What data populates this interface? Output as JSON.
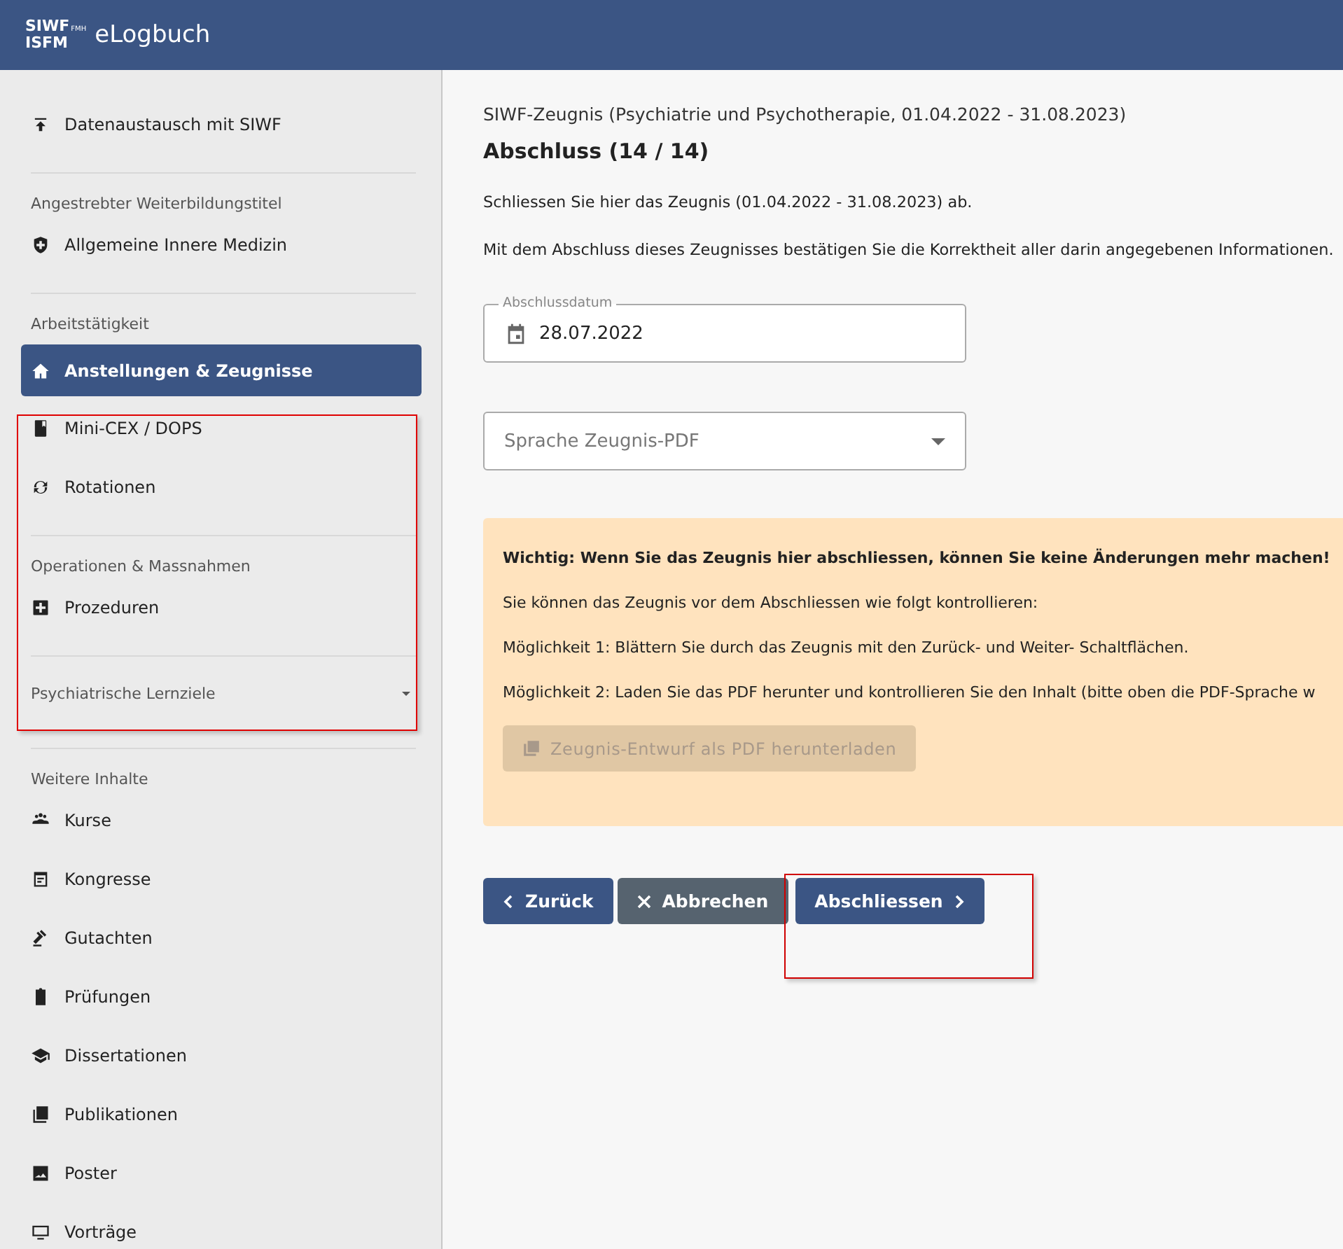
{
  "header": {
    "logo_top": "SIWF",
    "logo_sub": "FMH",
    "logo_bottom": "ISFM",
    "app_name": "eLogbuch"
  },
  "sidebar": {
    "groups": [
      {
        "kind": "links",
        "items": [
          {
            "label": "Datenaustausch mit SIWF",
            "selected": false
          }
        ]
      },
      {
        "kind": "links",
        "heading": "Angestrebter Weiterbildungstitel",
        "items": [
          {
            "label": "Allgemeine Innere Medizin",
            "selected": false
          }
        ]
      },
      {
        "kind": "links",
        "heading": "Arbeitstätigkeit",
        "items": [
          {
            "label": "Anstellungen & Zeugnisse",
            "selected": true
          },
          {
            "label": "Mini-CEX / DOPS",
            "selected": false
          },
          {
            "label": "Rotationen",
            "selected": false
          }
        ]
      },
      {
        "kind": "links",
        "heading": "Operationen & Massnahmen",
        "items": [
          {
            "label": "Prozeduren",
            "selected": false
          }
        ]
      },
      {
        "kind": "collapsible",
        "heading": "Psychiatrische Lernziele",
        "expanded": false
      },
      {
        "kind": "links",
        "heading": "Weitere Inhalte",
        "items": [
          {
            "label": "Kurse",
            "selected": false
          },
          {
            "label": "Kongresse",
            "selected": false
          },
          {
            "label": "Gutachten",
            "selected": false
          },
          {
            "label": "Prüfungen",
            "selected": false
          },
          {
            "label": "Dissertationen",
            "selected": false
          },
          {
            "label": "Publikationen",
            "selected": false
          },
          {
            "label": "Poster",
            "selected": false
          },
          {
            "label": "Vorträge",
            "selected": false
          }
        ]
      }
    ]
  },
  "main": {
    "breadcrumb": "SIWF-Zeugnis (Psychiatrie und Psychotherapie, 01.04.2022 - 31.08.2023)",
    "title": "Abschluss (14 / 14)",
    "paragraphs": [
      "Schliessen Sie hier das Zeugnis (01.04.2022 - 31.08.2023) ab.",
      "Mit dem Abschluss dieses Zeugnisses bestätigen Sie die Korrektheit aller darin angegebenen Informationen."
    ],
    "date_field": {
      "label": "Abschlussdatum",
      "value": "28.07.2022"
    },
    "language_select": {
      "placeholder": "Sprache Zeugnis-PDF"
    },
    "notice": {
      "warning": "Wichtig: Wenn Sie das Zeugnis hier abschliessen, können Sie keine Änderungen mehr machen!",
      "lines": [
        "Sie können das Zeugnis vor dem Abschliessen wie folgt kontrollieren:",
        "Möglichkeit 1: Blättern Sie durch das Zeugnis mit den Zurück- und Weiter- Schaltflächen.",
        "Möglichkeit 2: Laden Sie das PDF herunter und kontrollieren Sie den Inhalt (bitte oben die PDF-Sprache w"
      ],
      "download_button": {
        "label": "Zeugnis-Entwurf als PDF herunterladen",
        "disabled": true
      }
    },
    "buttons": [
      {
        "kind": "back",
        "label": "Zurück"
      },
      {
        "kind": "cancel",
        "label": "Abbrechen"
      },
      {
        "kind": "next",
        "label": "Abschliessen"
      }
    ]
  }
}
